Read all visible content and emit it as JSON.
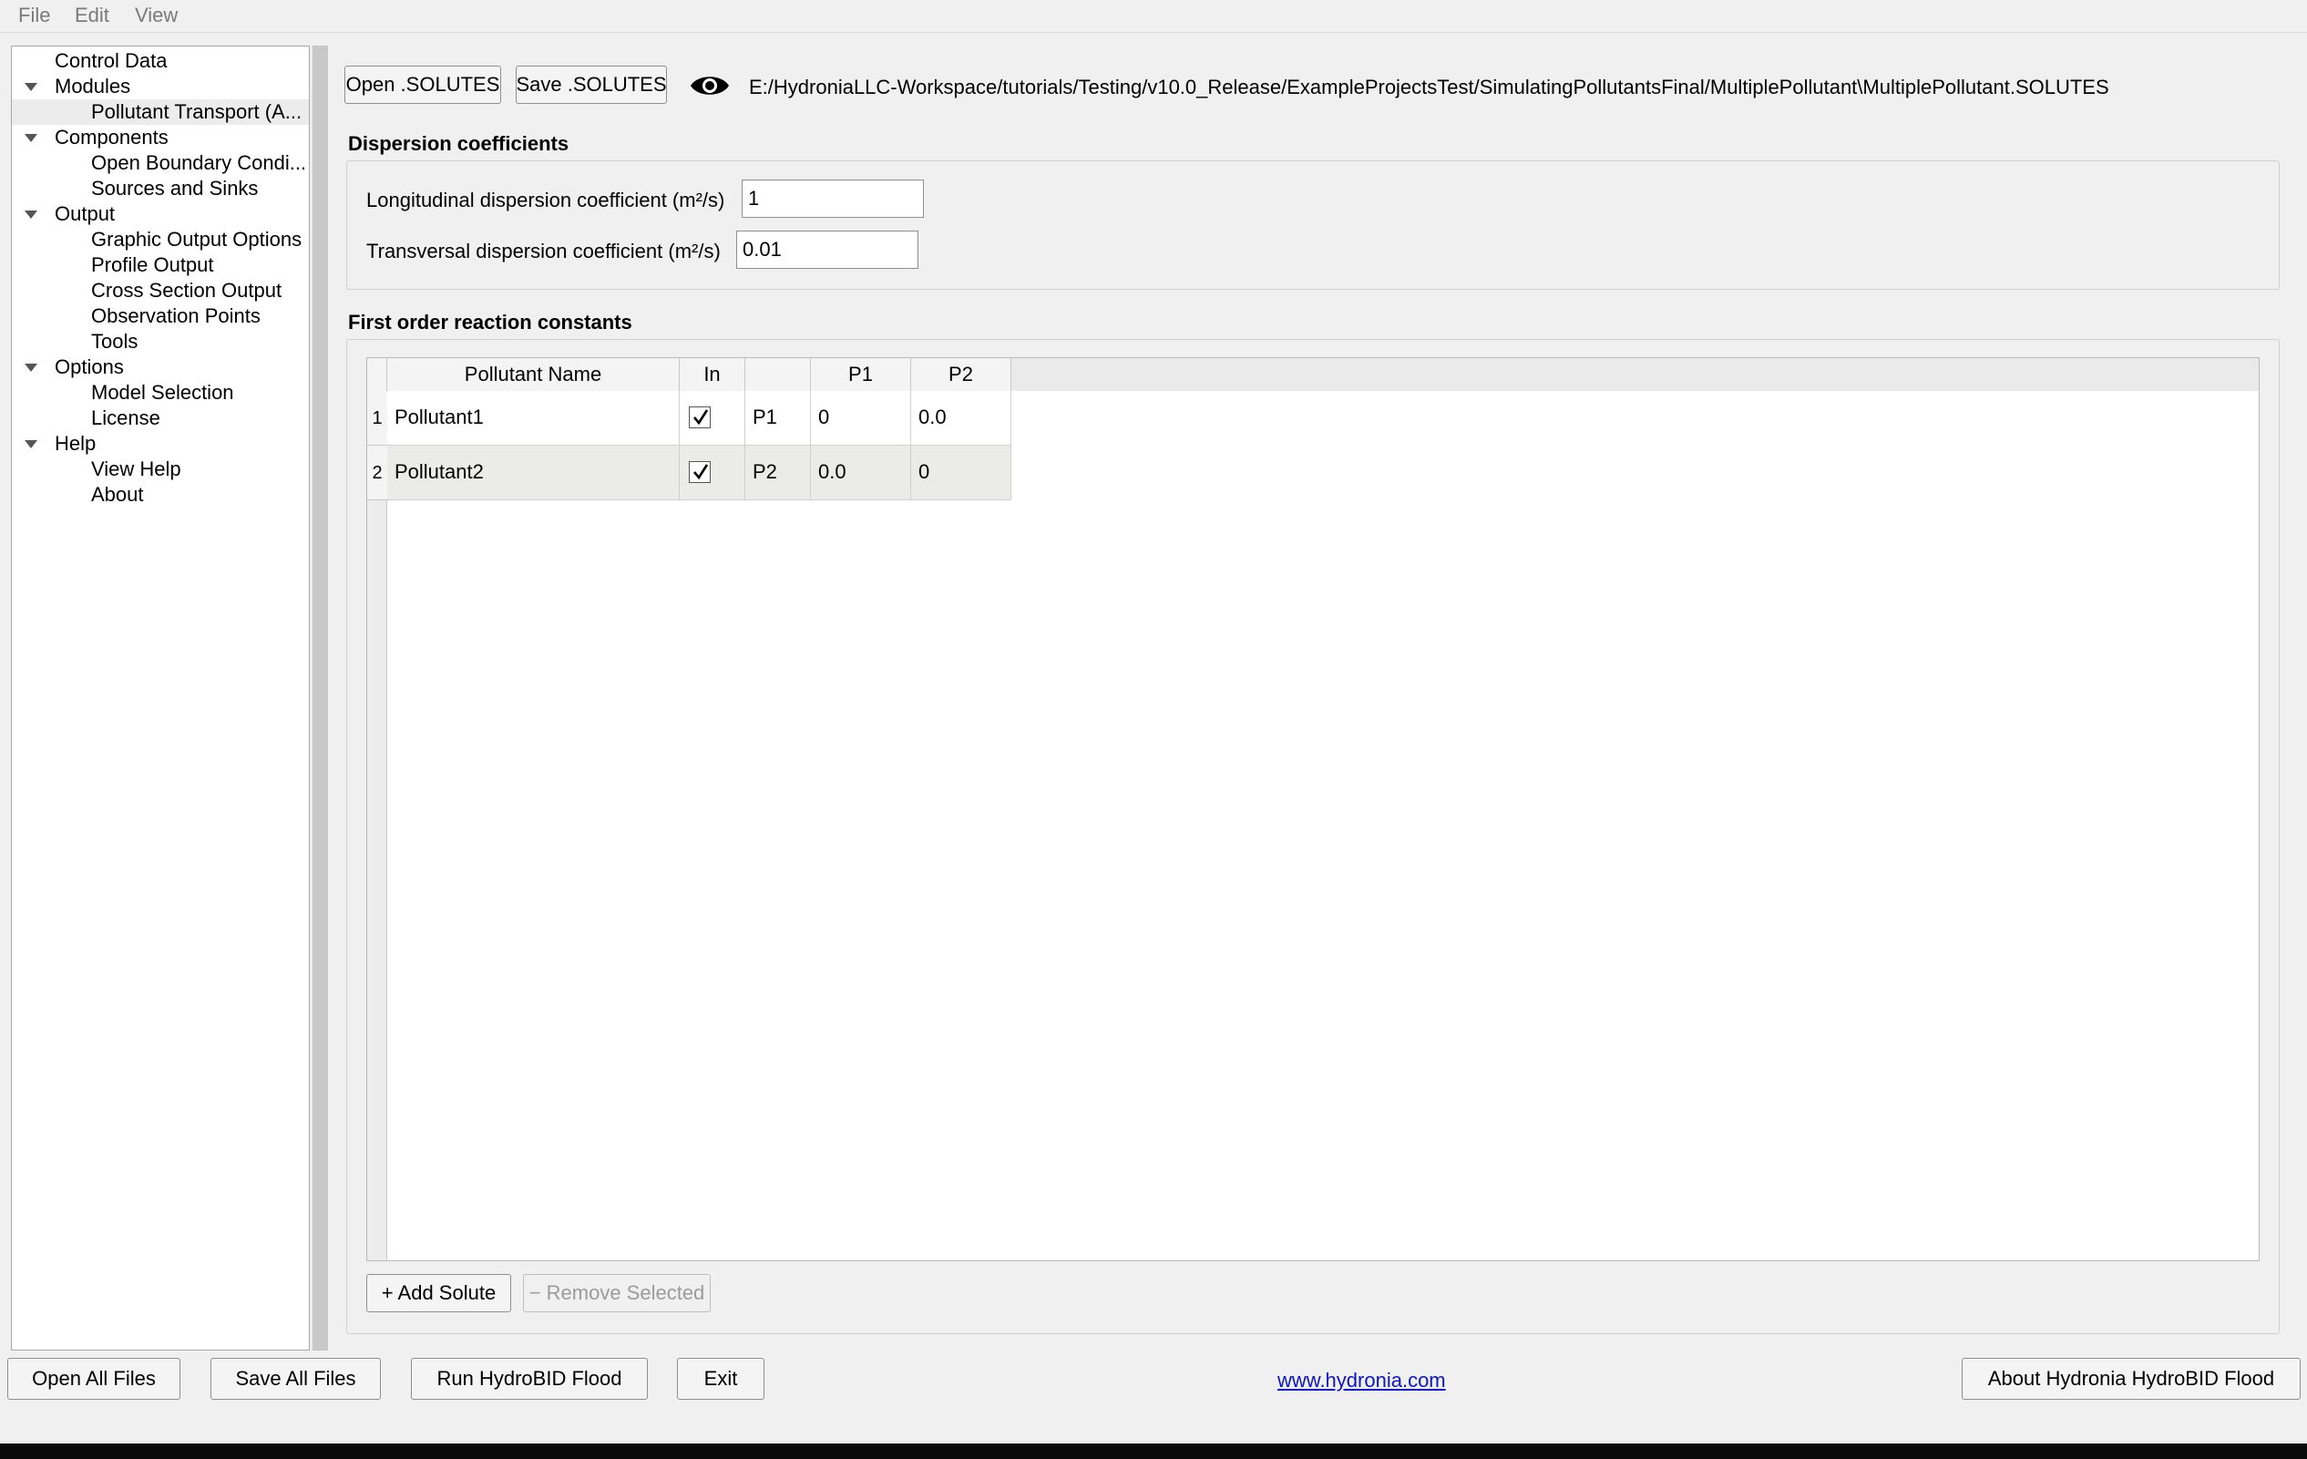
{
  "menu": {
    "file": "File",
    "edit": "Edit",
    "view": "View"
  },
  "tree": {
    "control_data": "Control Data",
    "modules": "Modules",
    "pollutant_transport": "Pollutant Transport (A...",
    "components": "Components",
    "open_boundary": "Open Boundary Condi...",
    "sources_sinks": "Sources and Sinks",
    "output": "Output",
    "graphic_output": "Graphic Output Options",
    "profile_output": "Profile Output",
    "cross_section": "Cross Section Output",
    "observation_points": "Observation Points",
    "tools": "Tools",
    "options": "Options",
    "model_selection": "Model Selection",
    "license": "License",
    "help": "Help",
    "view_help": "View Help",
    "about": "About"
  },
  "toolbar": {
    "open_solutes": "Open .SOLUTES",
    "save_solutes": "Save .SOLUTES",
    "file_path": "E:/HydroniaLLC-Workspace/tutorials/Testing/v10.0_Release/ExampleProjectsTest/SimulatingPollutantsFinal/MultiplePollutant\\MultiplePollutant.SOLUTES"
  },
  "dispersion": {
    "title": "Dispersion coefficients",
    "longitudinal_label": "Longitudinal dispersion coefficient (m²/s)",
    "longitudinal_value": "1",
    "transversal_label": "Transversal dispersion coefficient (m²/s)",
    "transversal_value": "0.01"
  },
  "reactions": {
    "title": "First order reaction constants",
    "columns": [
      "Pollutant Name",
      "In",
      "",
      "P1",
      "P2"
    ],
    "rows": [
      {
        "num": "1",
        "name": "Pollutant1",
        "in": true,
        "code": "P1",
        "p1": "0",
        "p2": "0.0"
      },
      {
        "num": "2",
        "name": "Pollutant2",
        "in": true,
        "code": "P2",
        "p1": "0.0",
        "p2": "0"
      }
    ],
    "add_label": "+ Add Solute",
    "remove_label": "− Remove Selected"
  },
  "footer": {
    "open_all": "Open All Files",
    "save_all": "Save All Files",
    "run": "Run HydroBID Flood",
    "exit": "Exit",
    "link": "www.hydronia.com",
    "about": "About Hydronia HydroBID Flood"
  },
  "icons": {
    "eye": "eye-icon",
    "tree_expand": "chevron-down-icon",
    "checkbox_check": "checkmark-icon"
  }
}
